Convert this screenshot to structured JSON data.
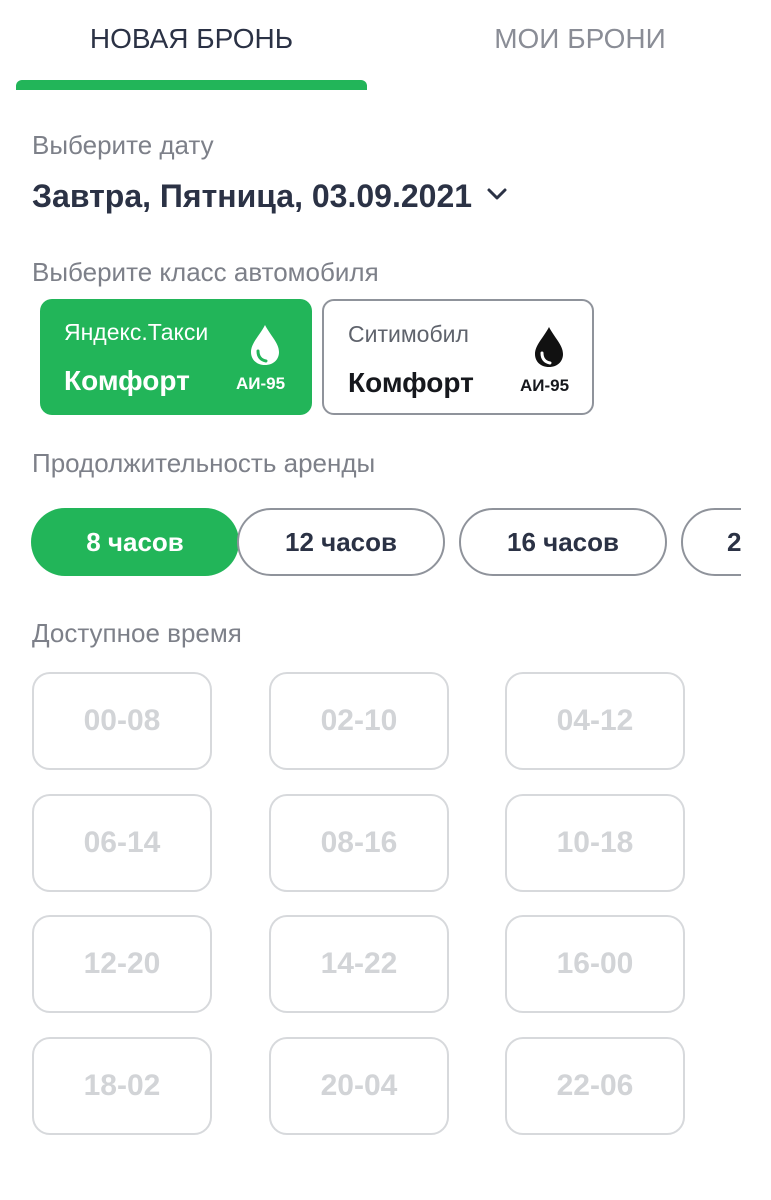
{
  "tabs": {
    "new_booking": "НОВАЯ БРОНЬ",
    "my_bookings": "МОИ БРОНИ"
  },
  "date": {
    "label": "Выберите дату",
    "value": "Завтра, Пятница, 03.09.2021"
  },
  "car_class": {
    "label": "Выберите класс автомобиля",
    "options": [
      {
        "provider": "Яндекс.Такси",
        "class": "Комфорт",
        "fuel": "АИ-95",
        "selected": true
      },
      {
        "provider": "Ситимобил",
        "class": "Комфорт",
        "fuel": "АИ-95",
        "selected": false
      }
    ]
  },
  "duration": {
    "label": "Продолжительность аренды",
    "options": [
      "8 часов",
      "12 часов",
      "16 часов",
      "2"
    ],
    "selected_index": 0
  },
  "time": {
    "label": "Доступное время",
    "slots": [
      "00-08",
      "02-10",
      "04-12",
      "06-14",
      "08-16",
      "10-18",
      "12-20",
      "14-22",
      "16-00",
      "18-02",
      "20-04",
      "22-06"
    ]
  },
  "colors": {
    "accent": "#22b559",
    "text_primary": "#2b3245",
    "text_secondary": "#7d8089",
    "disabled": "#d2d4d7"
  },
  "icons": [
    "chevron-down-icon",
    "fuel-drop-icon"
  ]
}
